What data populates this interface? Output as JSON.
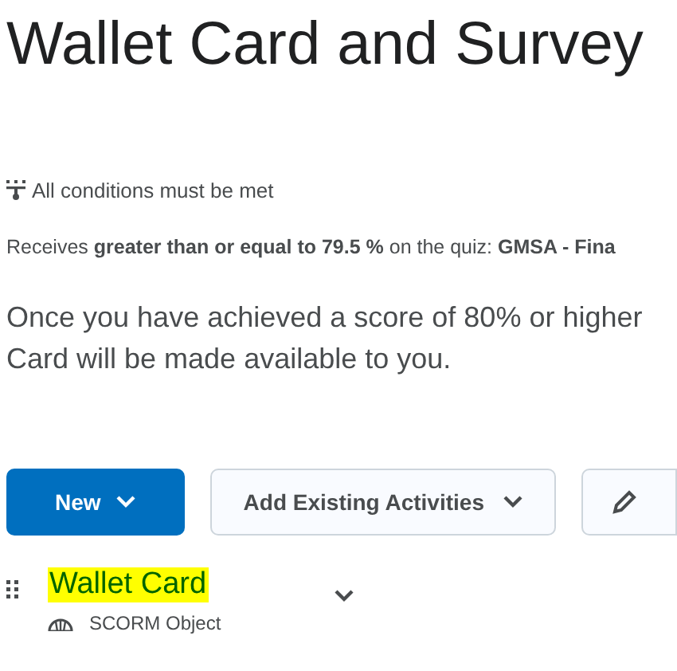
{
  "title": "Wallet Card and Survey",
  "conditions": {
    "heading": "All conditions must be met",
    "rule": "Receives **greater than or equal to 79.5 %** on the quiz: **GMSA - Fina**"
  },
  "message": [
    "Once you have achieved a score of 80% or higher",
    "Card will be made available to you."
  ],
  "toolbar": [
    {
      "kind": "primary",
      "label": "New"
    },
    {
      "kind": "secondary",
      "label": "Add Existing Activities"
    },
    {
      "kind": "icon"
    }
  ],
  "items": [
    {
      "title": "Wallet Card",
      "highlighted": true,
      "type": "SCORM Object"
    }
  ]
}
